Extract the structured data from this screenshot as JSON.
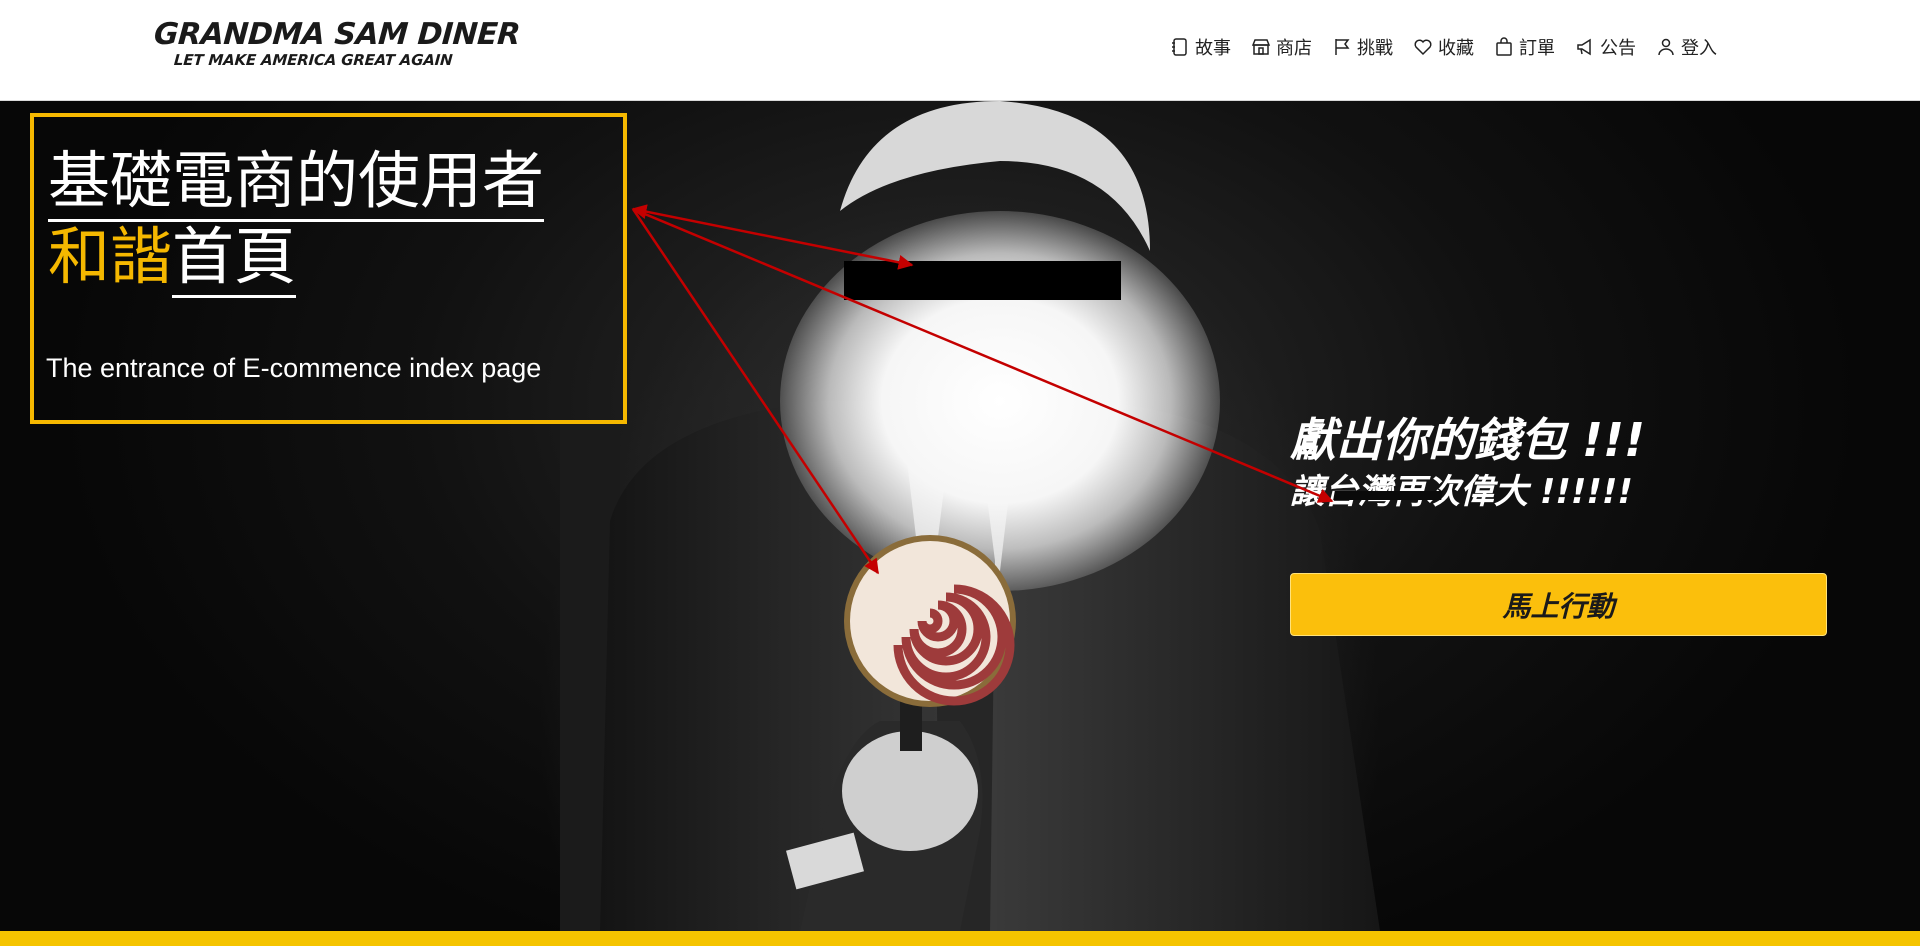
{
  "header": {
    "logo_title": "GRANDMA SAM DINER",
    "logo_tagline": "LET MAKE AMERICA GREAT AGAIN",
    "nav": [
      {
        "label": "故事",
        "icon": "notebook-icon"
      },
      {
        "label": "商店",
        "icon": "store-icon"
      },
      {
        "label": "挑戰",
        "icon": "flag-icon"
      },
      {
        "label": "收藏",
        "icon": "heart-icon"
      },
      {
        "label": "訂單",
        "icon": "bag-icon"
      },
      {
        "label": "公告",
        "icon": "megaphone-icon"
      },
      {
        "label": "登入",
        "icon": "user-icon"
      }
    ]
  },
  "hero": {
    "callout": {
      "title_line1": "基礎電商的使用者",
      "title_accent": "和諧",
      "title_rest": "首頁",
      "subtitle": "The entrance of E-commence index page"
    },
    "promo": {
      "line1": "獻出你的錢包 !!!",
      "line2": "讓台灣再次偉大 !!!!!!"
    },
    "cta_label": "馬上行動"
  },
  "colors": {
    "accent": "#f5b800",
    "cta": "#fbbf0c",
    "arrow": "#c40000",
    "bottom_bar": "#f5c400"
  }
}
